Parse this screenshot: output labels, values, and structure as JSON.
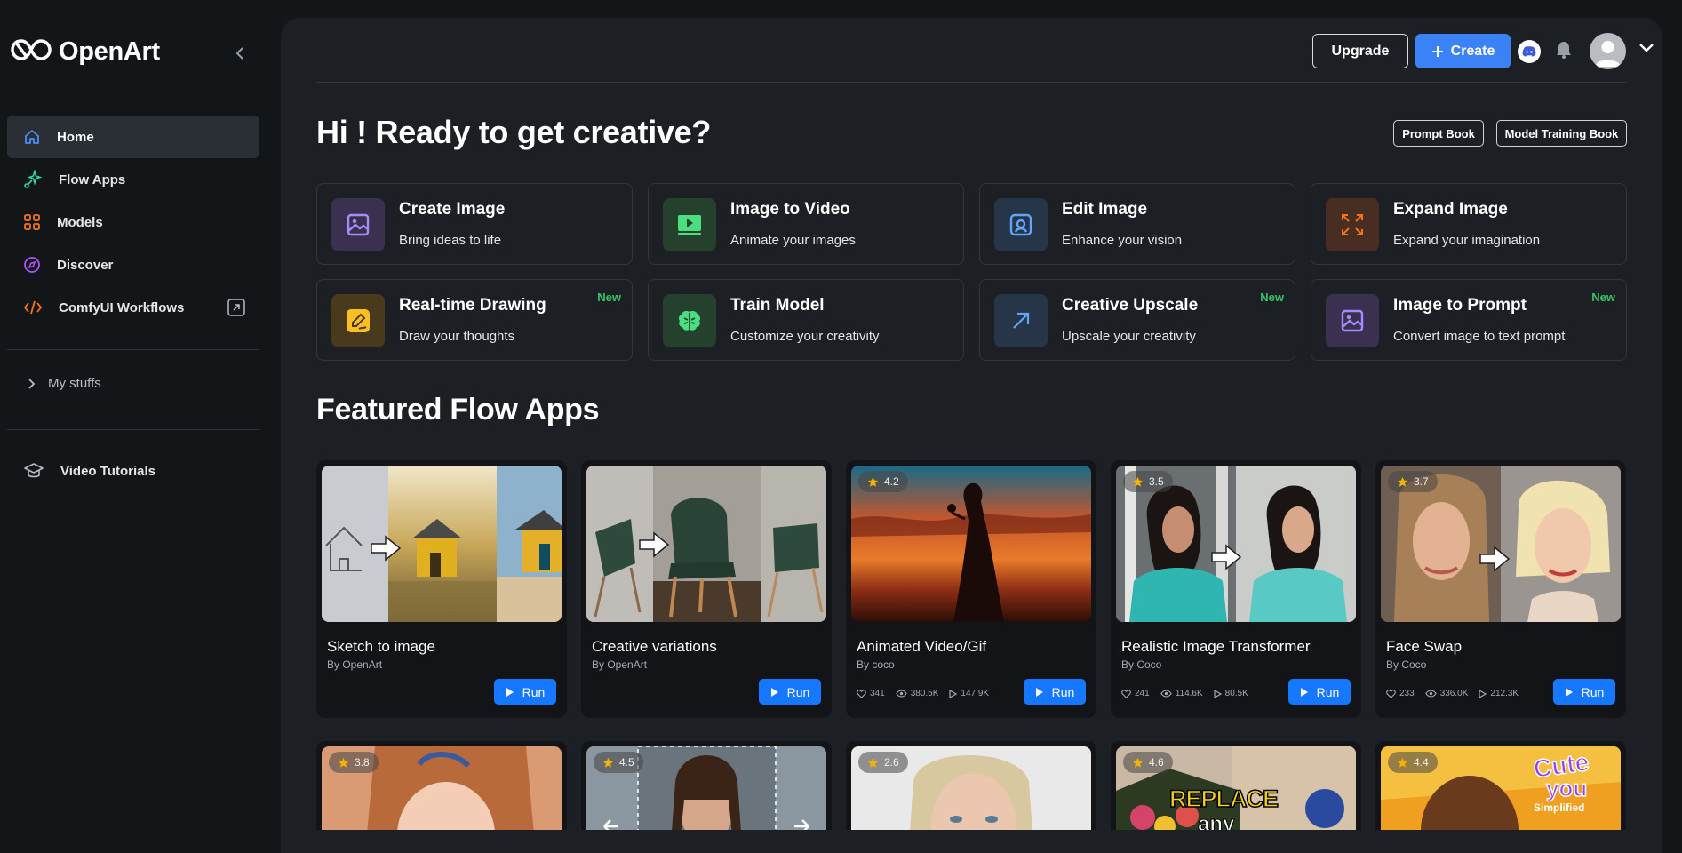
{
  "brand": {
    "name": "OpenArt"
  },
  "sidebar": {
    "items": [
      {
        "label": "Home",
        "icon": "home-icon",
        "color": "#4f8cf7"
      },
      {
        "label": "Flow Apps",
        "icon": "sparkle-network-icon",
        "color": "#34d399"
      },
      {
        "label": "Models",
        "icon": "grid-icon",
        "color": "#f97316"
      },
      {
        "label": "Discover",
        "icon": "compass-icon",
        "color": "#a855f7"
      },
      {
        "label": "ComfyUI Workflows",
        "icon": "code-icon",
        "color": "#f97316"
      }
    ],
    "my_stuffs": "My stuffs",
    "tutorials": "Video Tutorials"
  },
  "header": {
    "upgrade": "Upgrade",
    "create": "Create"
  },
  "hero": {
    "greeting": "Hi ! Ready to get creative?",
    "prompt_book": "Prompt Book",
    "model_training_book": "Model Training Book"
  },
  "tools": [
    {
      "title": "Create Image",
      "subtitle": "Bring ideas to life",
      "new": "",
      "icon": "image-icon",
      "color": "#a78bfa",
      "bg": "#3a3150"
    },
    {
      "title": "Image to Video",
      "subtitle": "Animate your images",
      "new": "",
      "icon": "play-screen-icon",
      "color": "#4ade80",
      "bg": "#26402e"
    },
    {
      "title": "Edit Image",
      "subtitle": "Enhance your vision",
      "new": "",
      "icon": "edit-image-icon",
      "color": "#60a5fa",
      "bg": "#263548"
    },
    {
      "title": "Expand Image",
      "subtitle": "Expand your imagination",
      "new": "",
      "icon": "expand-icon",
      "color": "#f97316",
      "bg": "#472d22"
    },
    {
      "title": "Real-time Drawing",
      "subtitle": "Draw your thoughts",
      "new": "New",
      "icon": "drawing-icon",
      "color": "#fbbf24",
      "bg": "#4a3a1c"
    },
    {
      "title": "Train Model",
      "subtitle": "Customize your creativity",
      "new": "",
      "icon": "brain-icon",
      "color": "#4ade80",
      "bg": "#26402e"
    },
    {
      "title": "Creative Upscale",
      "subtitle": "Upscale your creativity",
      "new": "New",
      "icon": "upscale-arrow-icon",
      "color": "#60a5fa",
      "bg": "#263548"
    },
    {
      "title": "Image to Prompt",
      "subtitle": "Convert image to text prompt",
      "new": "New",
      "icon": "image-icon",
      "color": "#a78bfa",
      "bg": "#3a3150"
    }
  ],
  "featured": {
    "title": "Featured Flow Apps",
    "run_label": "Run",
    "cards": [
      {
        "title": "Sketch to image",
        "by": "By OpenArt",
        "rating": "",
        "likes": "",
        "views": "",
        "runs": ""
      },
      {
        "title": "Creative variations",
        "by": "By OpenArt",
        "rating": "",
        "likes": "",
        "views": "",
        "runs": ""
      },
      {
        "title": "Animated Video/Gif",
        "by": "By coco",
        "rating": "4.2",
        "likes": "341",
        "views": "380.5K",
        "runs": "147.9K"
      },
      {
        "title": "Realistic Image Transformer",
        "by": "By Coco",
        "rating": "3.5",
        "likes": "241",
        "views": "114.6K",
        "runs": "80.5K"
      },
      {
        "title": "Face Swap",
        "by": "By Coco",
        "rating": "3.7",
        "likes": "233",
        "views": "336.0K",
        "runs": "212.3K"
      }
    ],
    "second_row_ratings": [
      "3.8",
      "4.5",
      "2.6",
      "4.6",
      "4.4"
    ],
    "second_row_overlay": {
      "replace": "REPLACE",
      "any": "any",
      "cute": "Cute",
      "you": "you",
      "simplified": "Simplified"
    }
  },
  "colors": {
    "accent": "#3b82f6",
    "run": "#1677ff",
    "new": "#36c46a",
    "star": "#f5b301"
  }
}
